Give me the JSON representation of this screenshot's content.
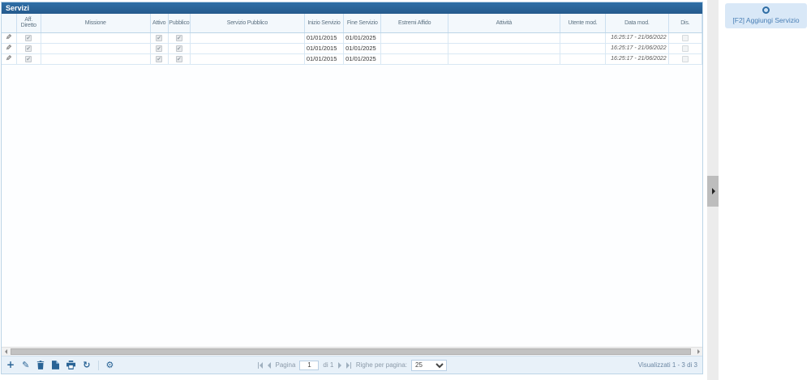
{
  "grid": {
    "title": "Servizi",
    "columns": [
      "Aff. Diretto",
      "Missione",
      "Attivo",
      "Pubblico",
      "Servizio Pubblico",
      "Inizio Servizio",
      "Fine Servizio",
      "Estremi Affido",
      "Attività",
      "Utente mod.",
      "Data mod.",
      "Dis."
    ],
    "rows": [
      {
        "edit_icon": "✎",
        "aff_diretto": "✔",
        "missione": "",
        "attivo": "✔",
        "pubblico": "✔",
        "servizio_pubblico": "",
        "inizio_servizio": "01/01/2015",
        "fine_servizio": "01/01/2025",
        "estremi_affido": "",
        "attivita": "",
        "utente_mod": "",
        "data_mod": "16:25:17 - 21/06/2022",
        "dis": ""
      },
      {
        "edit_icon": "✎",
        "aff_diretto": "✔",
        "missione": "",
        "attivo": "✔",
        "pubblico": "✔",
        "servizio_pubblico": "",
        "inizio_servizio": "01/01/2015",
        "fine_servizio": "01/01/2025",
        "estremi_affido": "",
        "attivita": "",
        "utente_mod": "",
        "data_mod": "16:25:17 - 21/06/2022",
        "dis": ""
      },
      {
        "edit_icon": "✎",
        "aff_diretto": "✔",
        "missione": "",
        "attivo": "✔",
        "pubblico": "✔",
        "servizio_pubblico": "",
        "inizio_servizio": "01/01/2015",
        "fine_servizio": "01/01/2025",
        "estremi_affido": "",
        "attivita": "",
        "utente_mod": "",
        "data_mod": "16:25:17 - 21/06/2022",
        "dis": ""
      }
    ]
  },
  "toolbar": {
    "add": "+",
    "refresh": "↻",
    "settings": "⚙"
  },
  "pager": {
    "page_label": "Pagina",
    "page_value": "1",
    "of_pages": "di 1",
    "rows_label": "Righe per pagina:",
    "rows_value": "25",
    "status": "Visualizzati 1 - 3 di 3"
  },
  "side_panel": {
    "add_button_label": "[F2] Aggiungi Servizio"
  },
  "colors": {
    "title_bar": "#28649c",
    "accent": "#2a6496"
  }
}
